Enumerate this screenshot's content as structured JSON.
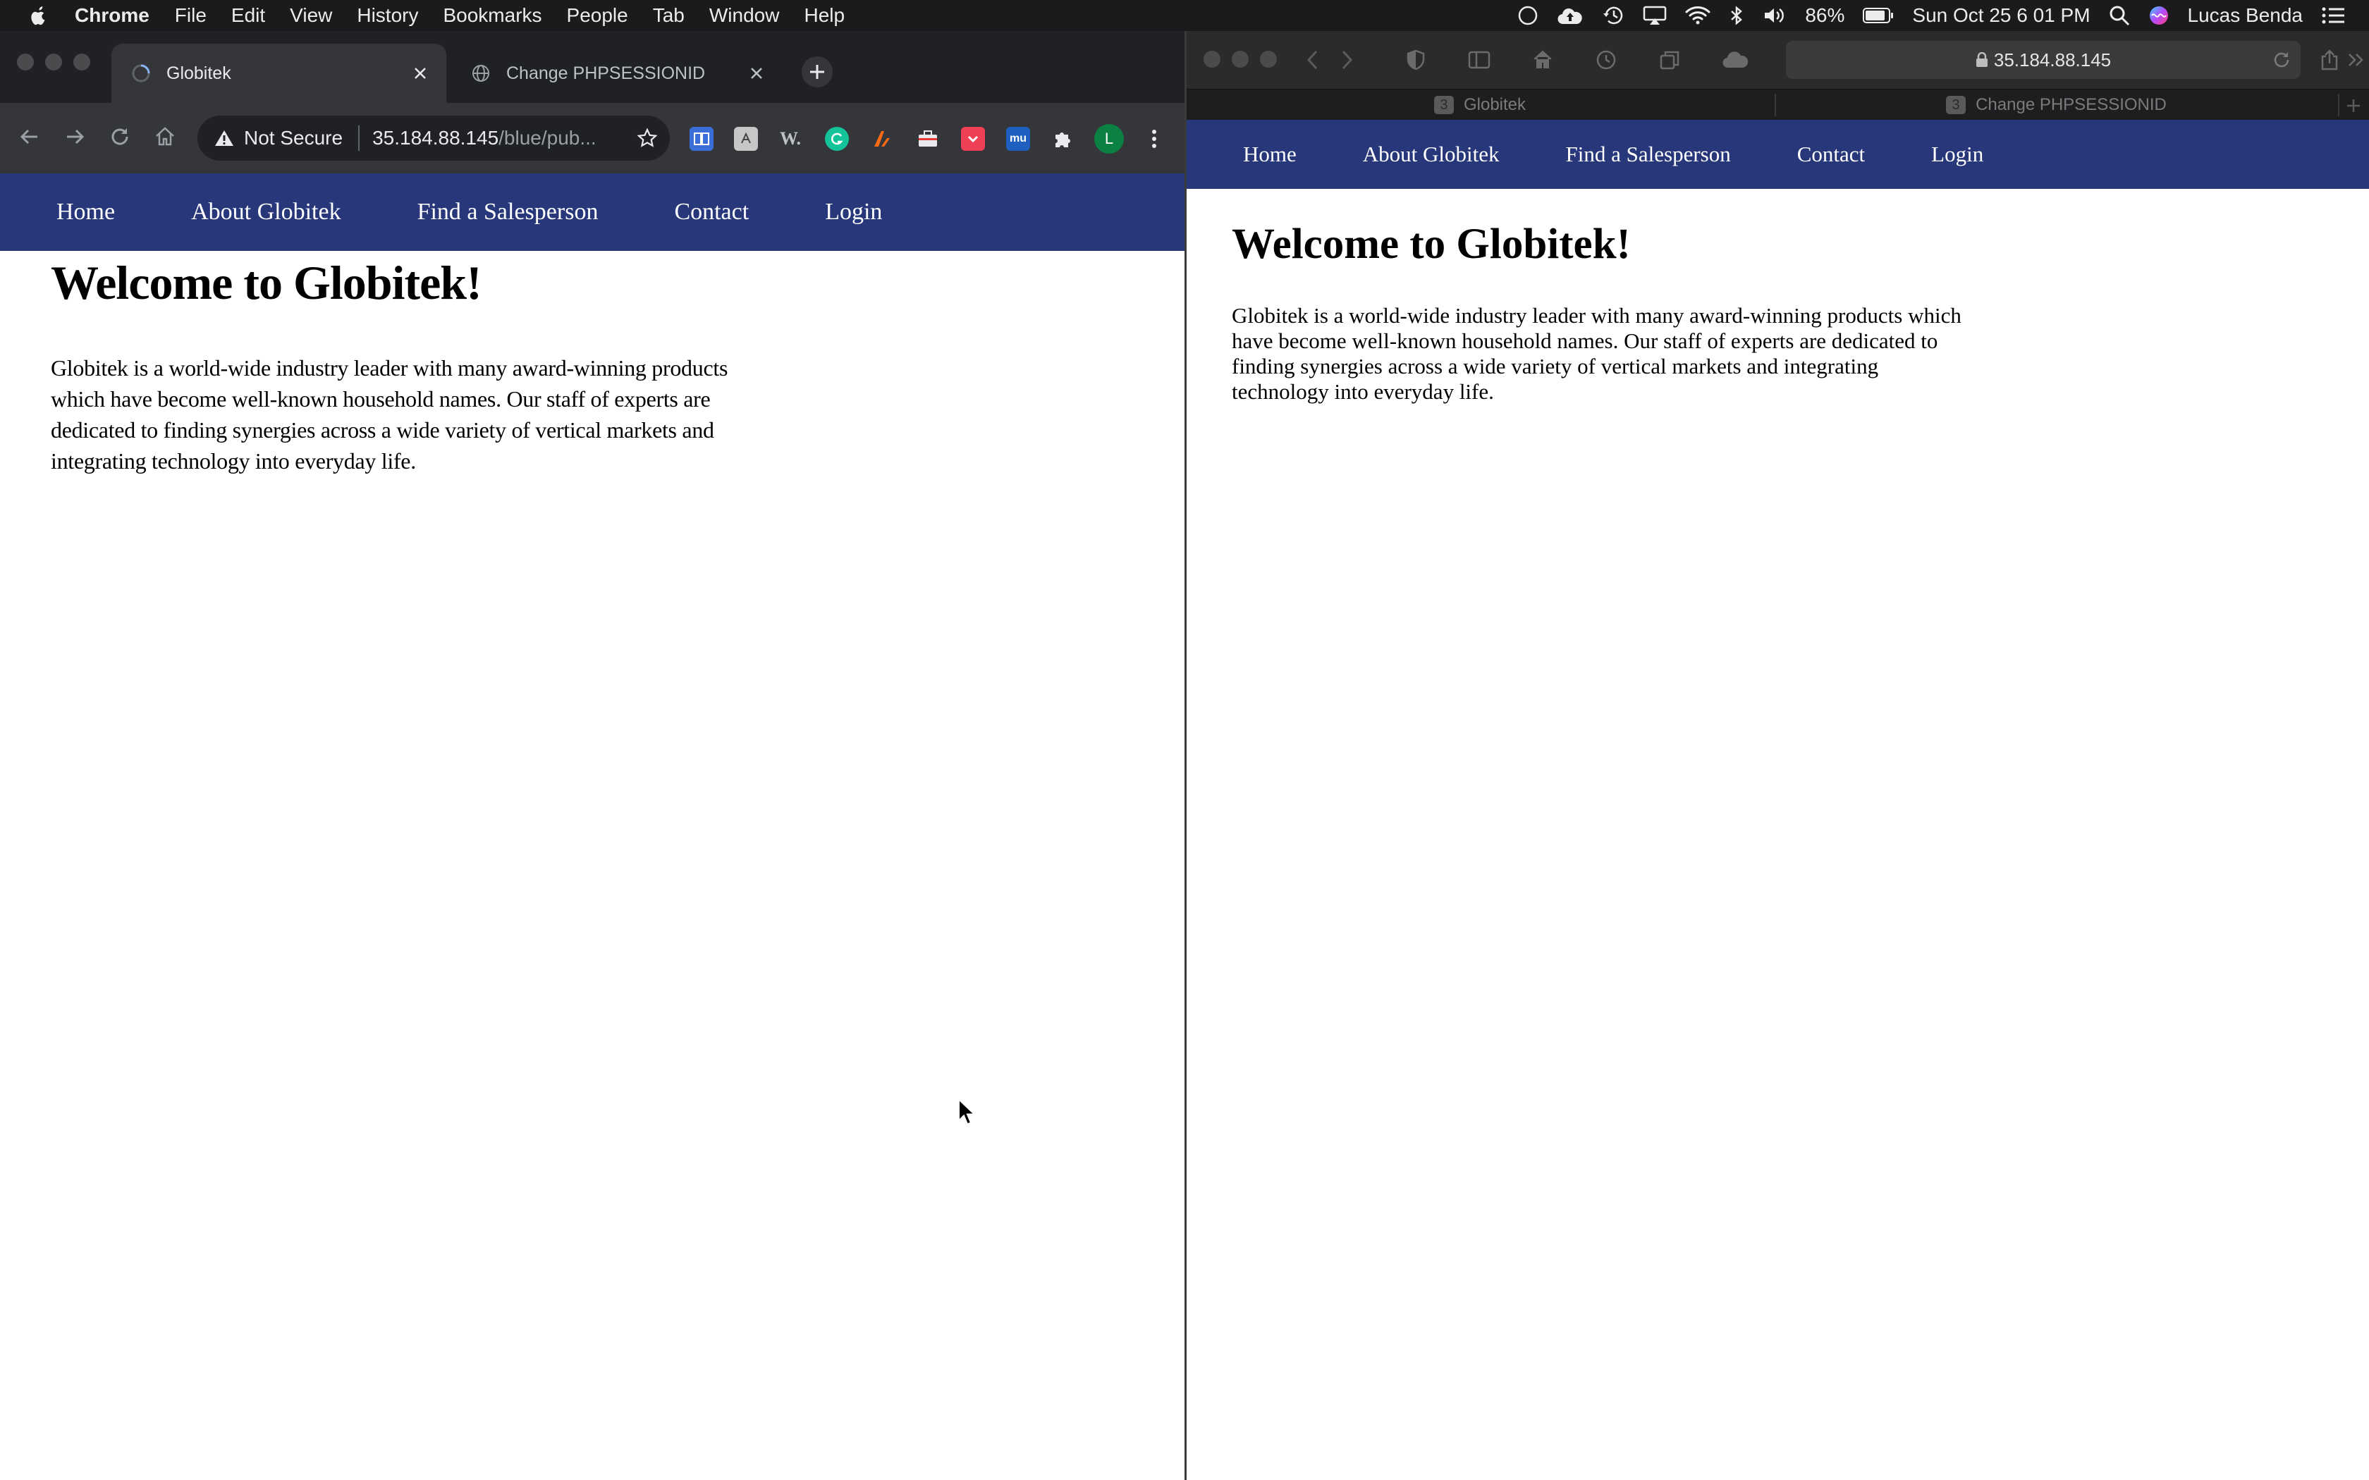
{
  "menubar": {
    "app_name": "Chrome",
    "items": [
      "File",
      "Edit",
      "View",
      "History",
      "Bookmarks",
      "People",
      "Tab",
      "Window",
      "Help"
    ],
    "battery": "86%",
    "datetime": "Sun Oct 25  6 01 PM",
    "user": "Lucas Benda"
  },
  "chrome": {
    "tabs": [
      {
        "title": "Globitek",
        "active": true
      },
      {
        "title": "Change PHPSESSIONID",
        "active": false
      }
    ],
    "omnibox": {
      "security": "Not Secure",
      "host": "35.184.88.145",
      "path": "/blue/pub..."
    },
    "profile_initial": "L"
  },
  "safari": {
    "address": "35.184.88.145",
    "tabs": [
      {
        "title": "Globitek",
        "count": "3"
      },
      {
        "title": "Change PHPSESSIONID",
        "count": "3"
      }
    ]
  },
  "site": {
    "nav": [
      "Home",
      "About Globitek",
      "Find a Salesperson",
      "Contact",
      "Login"
    ],
    "heading": "Welcome to Globitek!",
    "intro": "Globitek is a world-wide industry leader with many award-winning products which have become well-known household names. Our staff of experts are dedicated to finding synergies across a wide variety of vertical markets and integrating technology into everyday life."
  },
  "colors": {
    "site_nav_bg": "#28377a",
    "chrome_frame": "#202124",
    "safari_frame": "#2b2b2d"
  }
}
